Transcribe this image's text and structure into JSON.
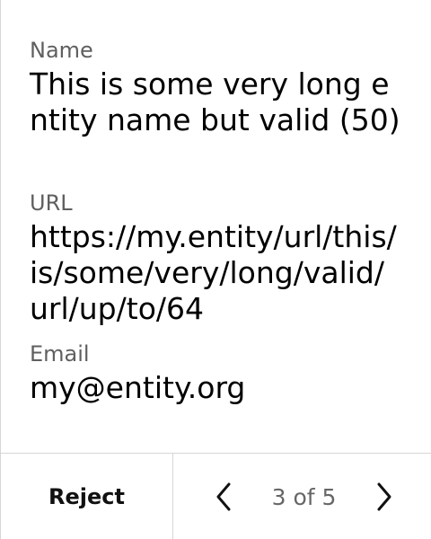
{
  "fields": {
    "name": {
      "label": "Name",
      "value": "This is some very long entity name but valid (50)"
    },
    "url": {
      "label": "URL",
      "value": "https://my.entity/url/this/is/some/very/long/valid/url/up/to/64"
    },
    "email": {
      "label": "Email",
      "value": "my@entity.org"
    }
  },
  "footer": {
    "reject_label": "Reject",
    "pager": {
      "current": 3,
      "total": 5,
      "text": "3 of 5",
      "prev_icon": "chevron-left-icon",
      "next_icon": "chevron-right-icon"
    }
  }
}
